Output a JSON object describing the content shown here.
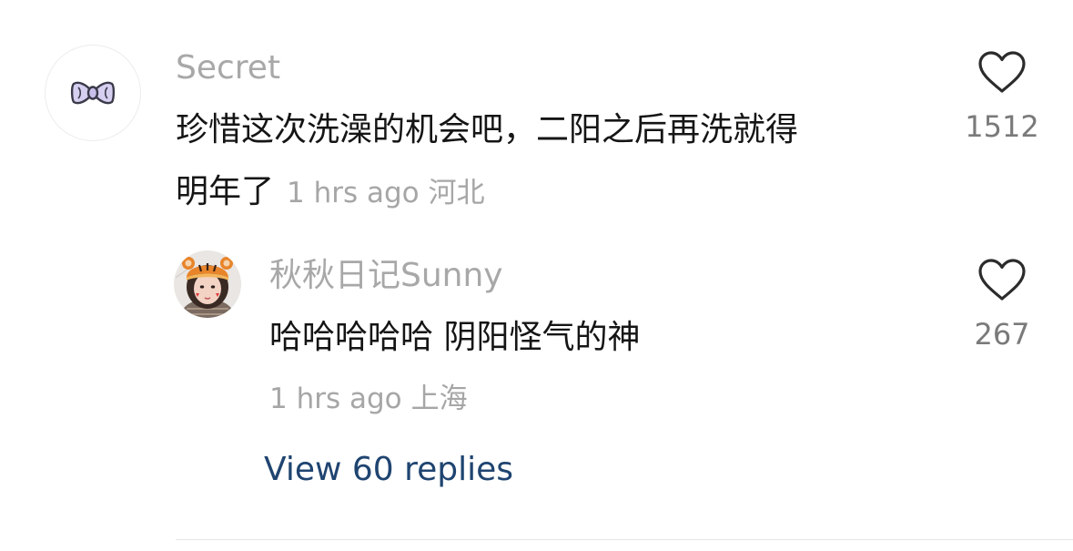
{
  "comment": {
    "author": "Secret",
    "avatar_icon": "bow-icon",
    "text_line1": "珍惜这次洗澡的机会吧，二阳之后再洗就得",
    "text_line2": "明年了",
    "time": "1 hrs ago",
    "location": "河北",
    "likes": "1512"
  },
  "reply": {
    "author": "秋秋日记Sunny",
    "avatar_icon": "tiger-hat-portrait",
    "text": "哈哈哈哈哈 阴阳怪气的神",
    "time": "1 hrs ago",
    "location": "上海",
    "likes": "267"
  },
  "view_replies_label": "View 60 replies",
  "colors": {
    "author_gray": "#a8a8a8",
    "link_blue": "#1f4470",
    "bow_lavender": "#d6cff0",
    "text_dark": "#151515"
  }
}
